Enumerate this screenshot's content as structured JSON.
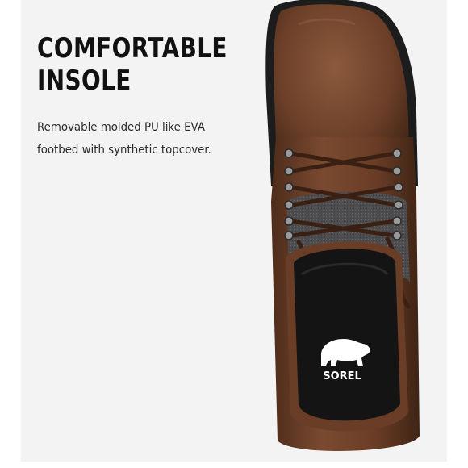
{
  "feature": {
    "title_lines": [
      "COMFORTABLE",
      "INSOLE"
    ],
    "description_lines": [
      "Removable molded PU like EVA",
      "footbed with synthetic topcover."
    ]
  },
  "brand": {
    "logo_icon": "polar-bear-icon",
    "logo_text": "SOREL"
  },
  "colors": {
    "panel_background": "#f3f3f3",
    "leather": "#6e4028",
    "insole": "#141414",
    "felt_collar": "#4a4a4d"
  }
}
